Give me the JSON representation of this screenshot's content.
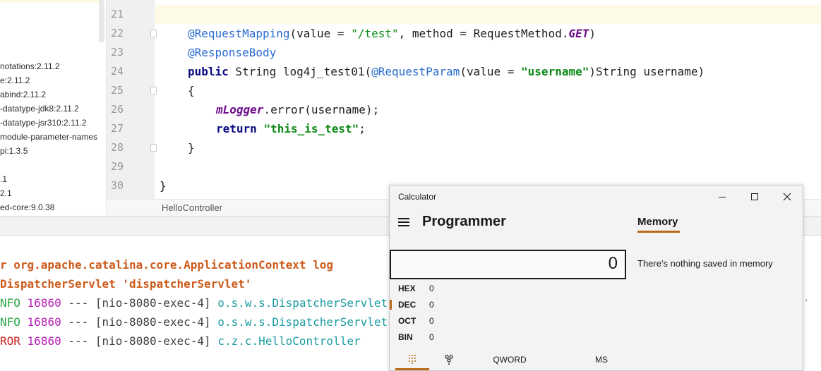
{
  "project_tree": {
    "items": [
      "notations:2.11.2",
      "e:2.11.2",
      "abind:2.11.2",
      "-datatype-jdk8:2.11.2",
      "-datatype-jsr310:2.11.2",
      "module-parameter-names",
      "pi:1.3.5",
      "",
      ".1",
      "2.1",
      "ed-core:9.0.38"
    ]
  },
  "editor": {
    "line_numbers": [
      "21",
      "22",
      "23",
      "24",
      "25",
      "26",
      "27",
      "28",
      "29",
      "30"
    ],
    "code": {
      "l22": {
        "anno": "@RequestMapping",
        "p1": "(value = ",
        "str": "\"/test\"",
        "p2": ", method = RequestMethod.",
        "const": "GET",
        "p3": ")"
      },
      "l23": {
        "anno": "@ResponseBody"
      },
      "l24": {
        "kw": "public",
        "p1": " String log4j_test01(",
        "anno": "@RequestParam",
        "p2": "(value = ",
        "str": "\"username\"",
        "p3": ")String username)"
      },
      "l25": {
        "text": "{"
      },
      "l26": {
        "field": "mLogger",
        "p1": ".error(username);"
      },
      "l27": {
        "kw": "return",
        "p1": " ",
        "str": "\"this_is_test\"",
        "p2": ";"
      },
      "l28": {
        "text": "}"
      },
      "l30": {
        "text": "}"
      }
    },
    "breadcrumb": "HelloController"
  },
  "console": {
    "line1": {
      "prefix": "r ",
      "text": "org.apache.catalina.core.ApplicationContext log"
    },
    "line2": {
      "text": "DispatcherServlet 'dispatcherServlet'"
    },
    "line3": {
      "level": "NFO",
      "pid": "16860",
      "sep": " --- ",
      "thread": "[nio-8080-exec-4]",
      "logger": "o.s.w.s.DispatcherServlet"
    },
    "line4": {
      "level": "NFO",
      "pid": "16860",
      "sep": " --- ",
      "thread": "[nio-8080-exec-4]",
      "logger": "o.s.w.s.DispatcherServlet"
    },
    "line5": {
      "level": "ROR",
      "pid": "16860",
      "sep": " --- ",
      "thread": "[nio-8080-exec-4]",
      "logger": "c.z.c.HelloController"
    },
    "right_tick": "'"
  },
  "calculator": {
    "title": "Calculator",
    "mode": "Programmer",
    "memory_tab": "Memory",
    "display": "0",
    "memory_empty": "There's nothing saved in memory",
    "radix": [
      {
        "name": "HEX",
        "value": "0"
      },
      {
        "name": "DEC",
        "value": "0"
      },
      {
        "name": "OCT",
        "value": "0"
      },
      {
        "name": "BIN",
        "value": "0"
      }
    ],
    "bottom": {
      "word_size": "QWORD",
      "ms": "MS"
    },
    "accent_color": "#b86a18"
  }
}
